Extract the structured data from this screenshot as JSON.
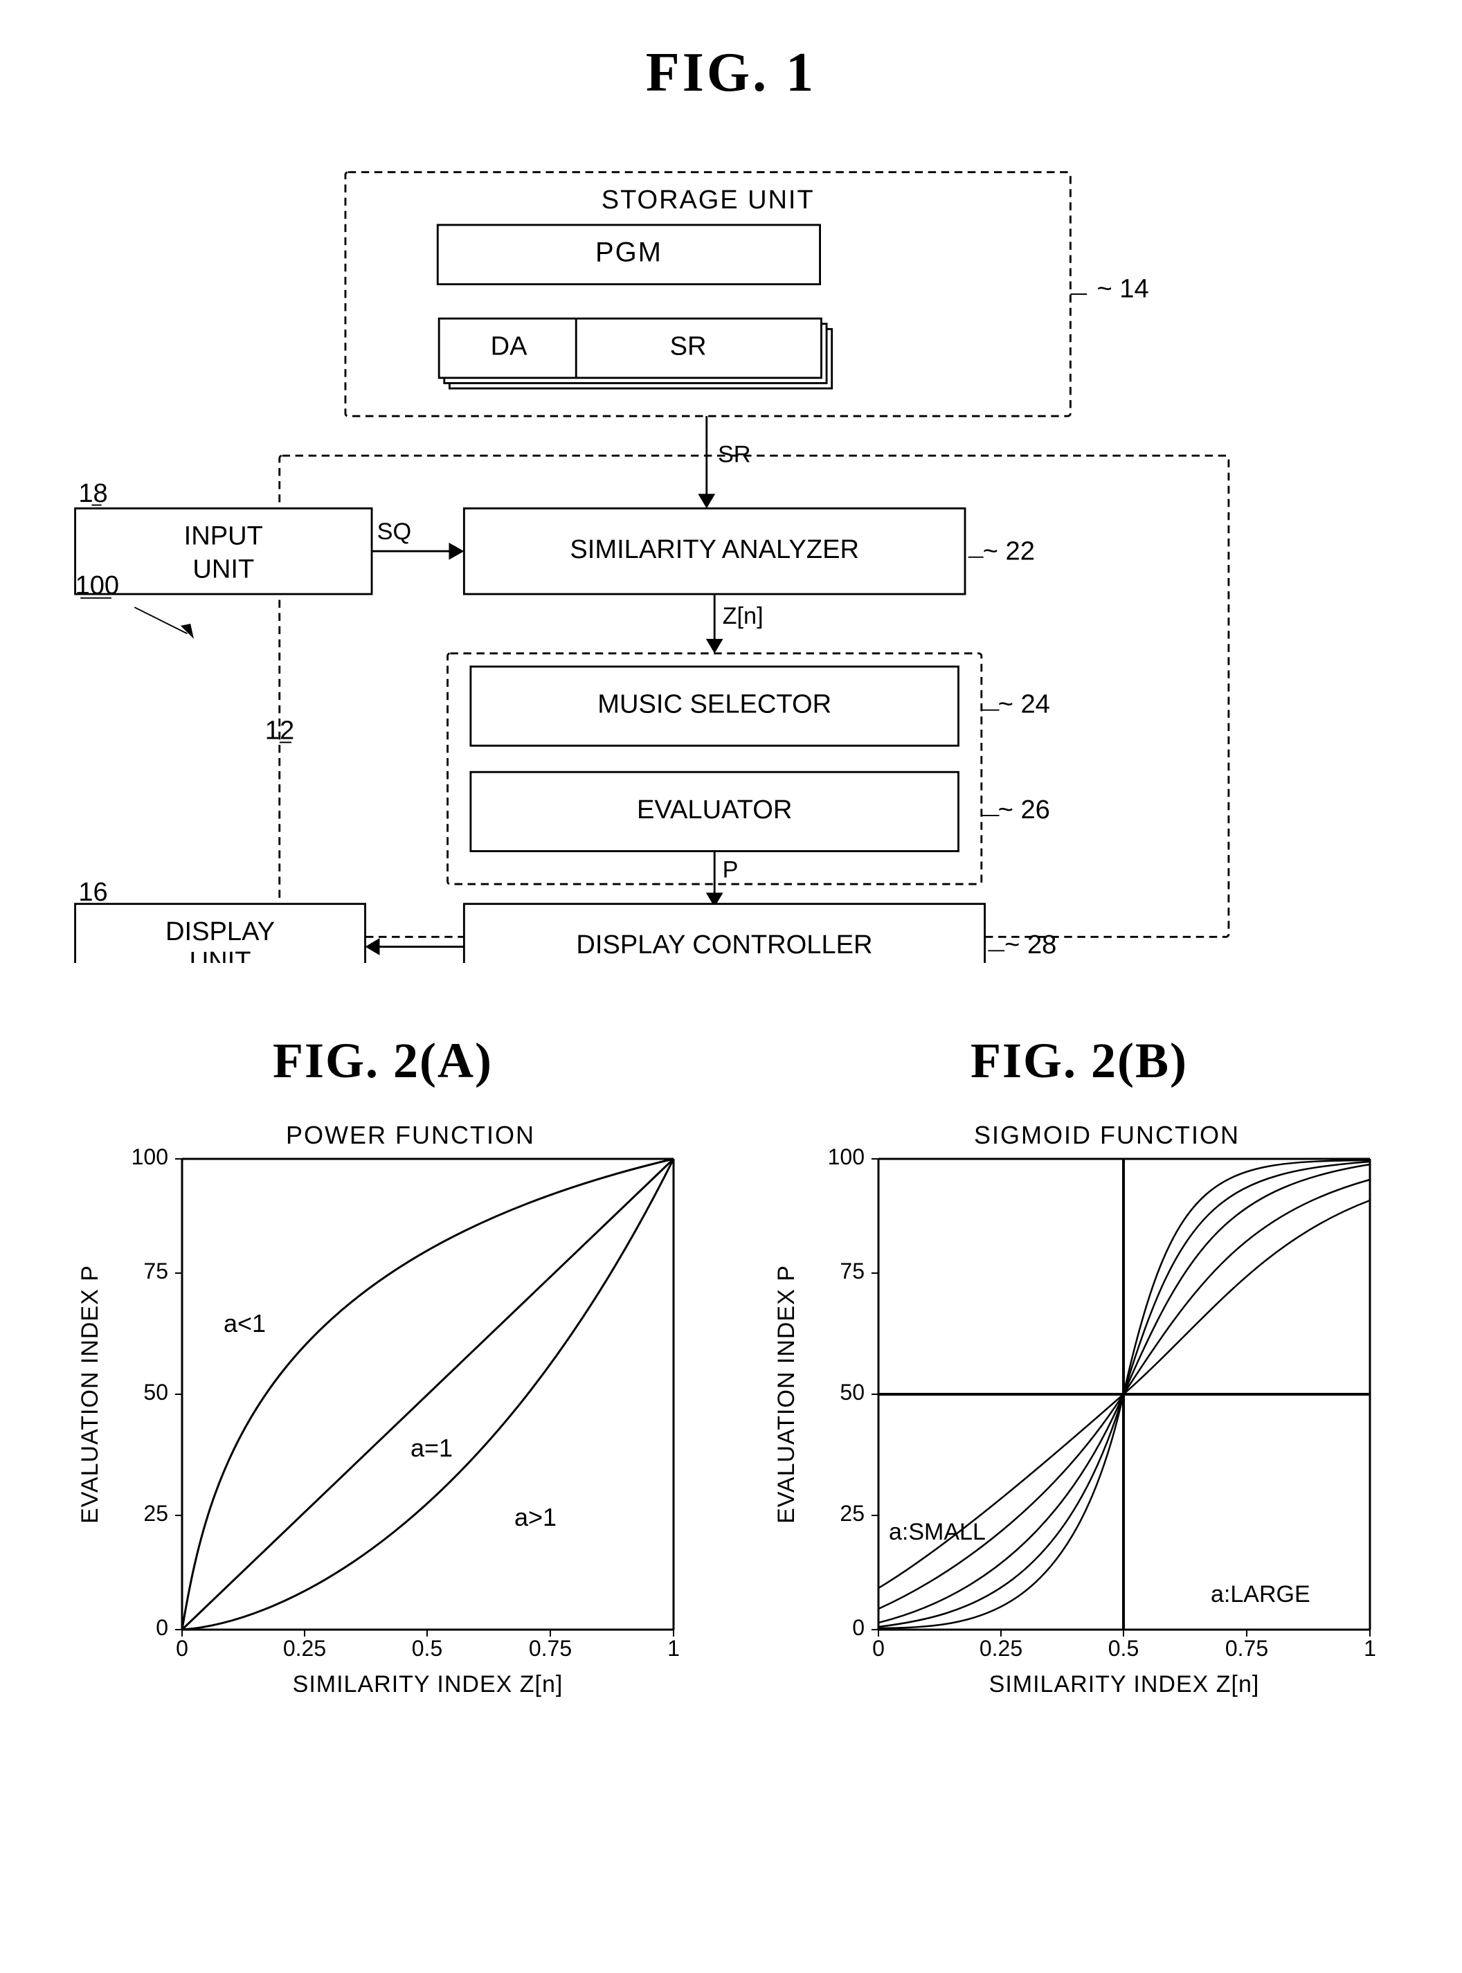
{
  "fig1": {
    "title": "FIG. 1",
    "storage_unit": {
      "label": "STORAGE UNIT",
      "ref": "14",
      "pgm_label": "PGM",
      "da_label": "DA",
      "sr_label": "SR"
    },
    "input_unit": {
      "label": "INPUT UNIT",
      "ref": "18"
    },
    "similarity_analyzer": {
      "label": "SIMILARITY ANALYZER",
      "ref": "22"
    },
    "music_selector": {
      "label": "MUSIC SELECTOR",
      "ref": "24"
    },
    "evaluator": {
      "label": "EVALUATOR",
      "ref": "26"
    },
    "display_controller": {
      "label": "DISPLAY CONTROLLER",
      "ref": "28"
    },
    "display_unit": {
      "label": "DISPLAY UNIT",
      "ref": "16"
    },
    "main_ref": "100",
    "inner_ref": "12",
    "arrow_sq": "SQ",
    "arrow_sr": "SR",
    "arrow_zn": "Z[n]",
    "arrow_p": "P"
  },
  "fig2a": {
    "title": "FIG. 2(A)",
    "chart_title": "POWER FUNCTION",
    "y_axis_label": "EVALUATION INDEX P",
    "x_axis_label": "SIMILARITY INDEX Z[n]",
    "y_ticks": [
      "0",
      "25",
      "50",
      "75",
      "100"
    ],
    "x_ticks": [
      "0",
      "0.25",
      "0.5",
      "0.75",
      "1"
    ],
    "curves": [
      {
        "label": "a<1",
        "type": "power_less"
      },
      {
        "label": "a=1",
        "type": "linear"
      },
      {
        "label": "a>1",
        "type": "power_greater"
      }
    ]
  },
  "fig2b": {
    "title": "FIG. 2(B)",
    "chart_title": "SIGMOID FUNCTION",
    "y_axis_label": "EVALUATION INDEX P",
    "x_axis_label": "SIMILARITY INDEX Z[n]",
    "y_ticks": [
      "0",
      "25",
      "50",
      "75",
      "100"
    ],
    "x_ticks": [
      "0",
      "0.25",
      "0.5",
      "0.75",
      "1"
    ],
    "labels": {
      "small": "a:SMALL",
      "large": "a:LARGE"
    },
    "hline_y": 50,
    "vline_x": 0.5
  }
}
